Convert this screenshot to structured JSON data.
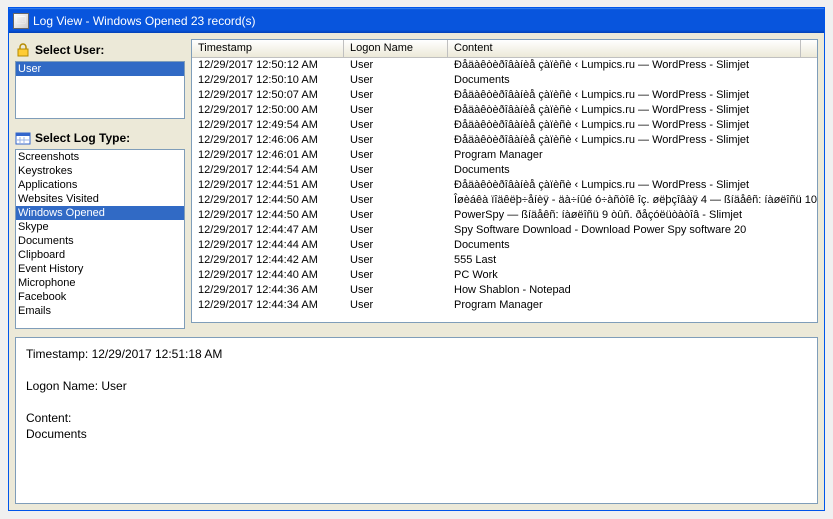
{
  "window": {
    "title": "Log View - Windows Opened 23 record(s)"
  },
  "users_section": {
    "label": "Select User:",
    "items": [
      "User"
    ],
    "selected_index": 0
  },
  "logtypes_section": {
    "label": "Select Log Type:",
    "items": [
      "Screenshots",
      "Keystrokes",
      "Applications",
      "Websites Visited",
      "Windows Opened",
      "Skype",
      "Documents",
      "Clipboard",
      "Event History",
      "Microphone",
      "Facebook",
      "Emails"
    ],
    "selected_index": 4
  },
  "columns": {
    "timestamp": "Timestamp",
    "logon": "Logon Name",
    "content": "Content"
  },
  "rows": [
    {
      "ts": "12/29/2017 12:50:12 AM",
      "logon": "User",
      "content": "Ðåäàêòèðîâàíèå çàïèñè ‹ Lumpics.ru — WordPress - Slimjet"
    },
    {
      "ts": "12/29/2017 12:50:10 AM",
      "logon": "User",
      "content": "Documents"
    },
    {
      "ts": "12/29/2017 12:50:07 AM",
      "logon": "User",
      "content": "Ðåäàêòèðîâàíèå çàïèñè ‹ Lumpics.ru — WordPress - Slimjet"
    },
    {
      "ts": "12/29/2017 12:50:00 AM",
      "logon": "User",
      "content": "Ðåäàêòèðîâàíèå çàïèñè ‹ Lumpics.ru — WordPress - Slimjet"
    },
    {
      "ts": "12/29/2017 12:49:54 AM",
      "logon": "User",
      "content": "Ðåäàêòèðîâàíèå çàïèñè ‹ Lumpics.ru — WordPress - Slimjet"
    },
    {
      "ts": "12/29/2017 12:46:06 AM",
      "logon": "User",
      "content": "Ðåäàêòèðîâàíèå çàïèñè ‹ Lumpics.ru — WordPress - Slimjet"
    },
    {
      "ts": "12/29/2017 12:46:01 AM",
      "logon": "User",
      "content": "Program Manager"
    },
    {
      "ts": "12/29/2017 12:44:54 AM",
      "logon": "User",
      "content": "Documents"
    },
    {
      "ts": "12/29/2017 12:44:51 AM",
      "logon": "User",
      "content": "Ðåäàêòèðîâàíèå çàïèñè ‹ Lumpics.ru — WordPress - Slimjet"
    },
    {
      "ts": "12/29/2017 12:44:50 AM",
      "logon": "User",
      "content": "Îøèáêà ïîäêëþ÷åíèÿ - äà÷íûé ó÷àñòîê îç. øëþçîâàÿ 4 — ßíäåêñ: íàøëîñü 10"
    },
    {
      "ts": "12/29/2017 12:44:50 AM",
      "logon": "User",
      "content": "PowerSpy — ßíäåêñ: íàøëîñü 9 òûñ. ðåçóëüòàòîâ - Slimjet"
    },
    {
      "ts": "12/29/2017 12:44:47 AM",
      "logon": "User",
      "content": "Spy Software Download - Download Power Spy software 20"
    },
    {
      "ts": "12/29/2017 12:44:44 AM",
      "logon": "User",
      "content": "Documents"
    },
    {
      "ts": "12/29/2017 12:44:42 AM",
      "logon": "User",
      "content": "555 Last"
    },
    {
      "ts": "12/29/2017 12:44:40 AM",
      "logon": "User",
      "content": "PC Work"
    },
    {
      "ts": "12/29/2017 12:44:36 AM",
      "logon": "User",
      "content": "How Shablon - Notepad"
    },
    {
      "ts": "12/29/2017 12:44:34 AM",
      "logon": "User",
      "content": "Program Manager"
    }
  ],
  "detail": {
    "timestamp_label": "Timestamp:",
    "timestamp_value": "12/29/2017 12:51:18 AM",
    "logon_label": "Logon Name:",
    "logon_value": "User",
    "content_label": "Content:",
    "content_value": "Documents"
  }
}
